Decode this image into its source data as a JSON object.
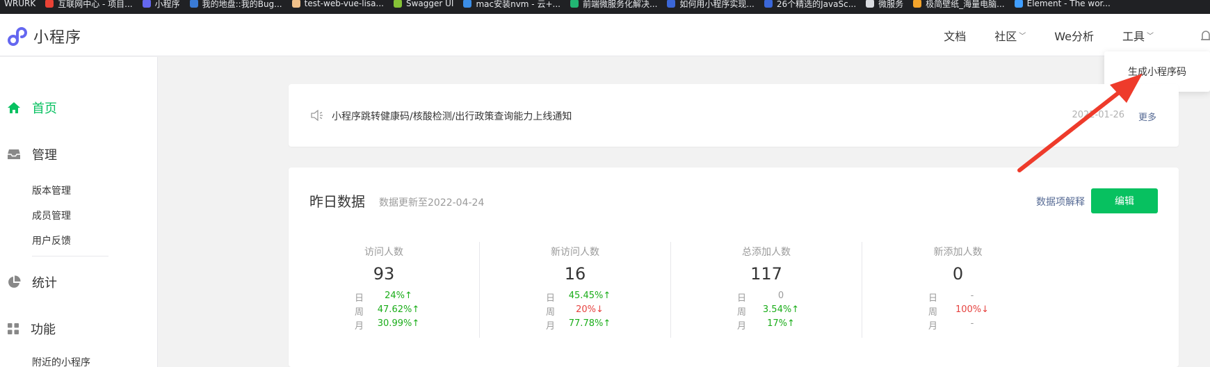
{
  "bookmarks": [
    {
      "label": "WRURK",
      "color": "#202124"
    },
    {
      "label": "互联网中心 - 项目...",
      "color": "#e94235"
    },
    {
      "label": "小程序",
      "color": "#6467f0"
    },
    {
      "label": "我的地盘::我的Bug...",
      "color": "#3a7bd5"
    },
    {
      "label": "test-web-vue-lisa...",
      "color": "#f0c08a"
    },
    {
      "label": "Swagger UI",
      "color": "#85c236"
    },
    {
      "label": "mac安装nvm - 云+...",
      "color": "#3b8ee8"
    },
    {
      "label": "前端微服务化解决...",
      "color": "#22b573"
    },
    {
      "label": "如何用小程序实现...",
      "color": "#3b67d8"
    },
    {
      "label": "26个精选的JavaSc...",
      "color": "#3b67d8"
    },
    {
      "label": "微服务",
      "color": "#dadce0"
    },
    {
      "label": "极简壁纸_海量电脑...",
      "color": "#f4a42b"
    },
    {
      "label": "Element - The wor...",
      "color": "#409eff"
    }
  ],
  "header": {
    "logo_text": "小程序",
    "nav": [
      {
        "label": "文档",
        "has_chevron": false
      },
      {
        "label": "社区",
        "has_chevron": true
      },
      {
        "label": "We分析",
        "has_chevron": false
      },
      {
        "label": "工具",
        "has_chevron": true
      }
    ],
    "chevron_glyph": "﹀"
  },
  "dropdown": {
    "item": "生成小程序码"
  },
  "sidebar": {
    "home": "首页",
    "manage": "管理",
    "manage_items": [
      "版本管理",
      "成员管理",
      "用户反馈"
    ],
    "stats": "统计",
    "features": "功能",
    "feature_items": [
      "附近的小程序"
    ]
  },
  "notice": {
    "text": "小程序跳转健康码/核酸检测/出行政策查询能力上线通知",
    "date": "2022-01-26",
    "more": "更多"
  },
  "stats": {
    "title": "昨日数据",
    "subtitle": "数据更新至2022-04-24",
    "explain": "数据项解释",
    "edit": "编辑",
    "row_keys": [
      "日",
      "周",
      "月"
    ],
    "metrics": [
      {
        "label": "访问人数",
        "value": "93",
        "rows": [
          {
            "v": "24%↑",
            "t": "up"
          },
          {
            "v": "47.62%↑",
            "t": "up"
          },
          {
            "v": "30.99%↑",
            "t": "up"
          }
        ]
      },
      {
        "label": "新访问人数",
        "value": "16",
        "rows": [
          {
            "v": "45.45%↑",
            "t": "up"
          },
          {
            "v": "20%↓",
            "t": "down"
          },
          {
            "v": "77.78%↑",
            "t": "up"
          }
        ]
      },
      {
        "label": "总添加人数",
        "value": "117",
        "rows": [
          {
            "v": "0",
            "t": "none"
          },
          {
            "v": "3.54%↑",
            "t": "up"
          },
          {
            "v": "17%↑",
            "t": "up"
          }
        ]
      },
      {
        "label": "新添加人数",
        "value": "0",
        "rows": [
          {
            "v": "-",
            "t": "none"
          },
          {
            "v": "100%↓",
            "t": "down"
          },
          {
            "v": "-",
            "t": "none"
          }
        ]
      }
    ]
  },
  "colors": {
    "brand_green": "#07c160",
    "up_green": "#1aad19",
    "down_red": "#e64340",
    "link_blue": "#576b95",
    "annotation_red": "#ee3b2b"
  }
}
